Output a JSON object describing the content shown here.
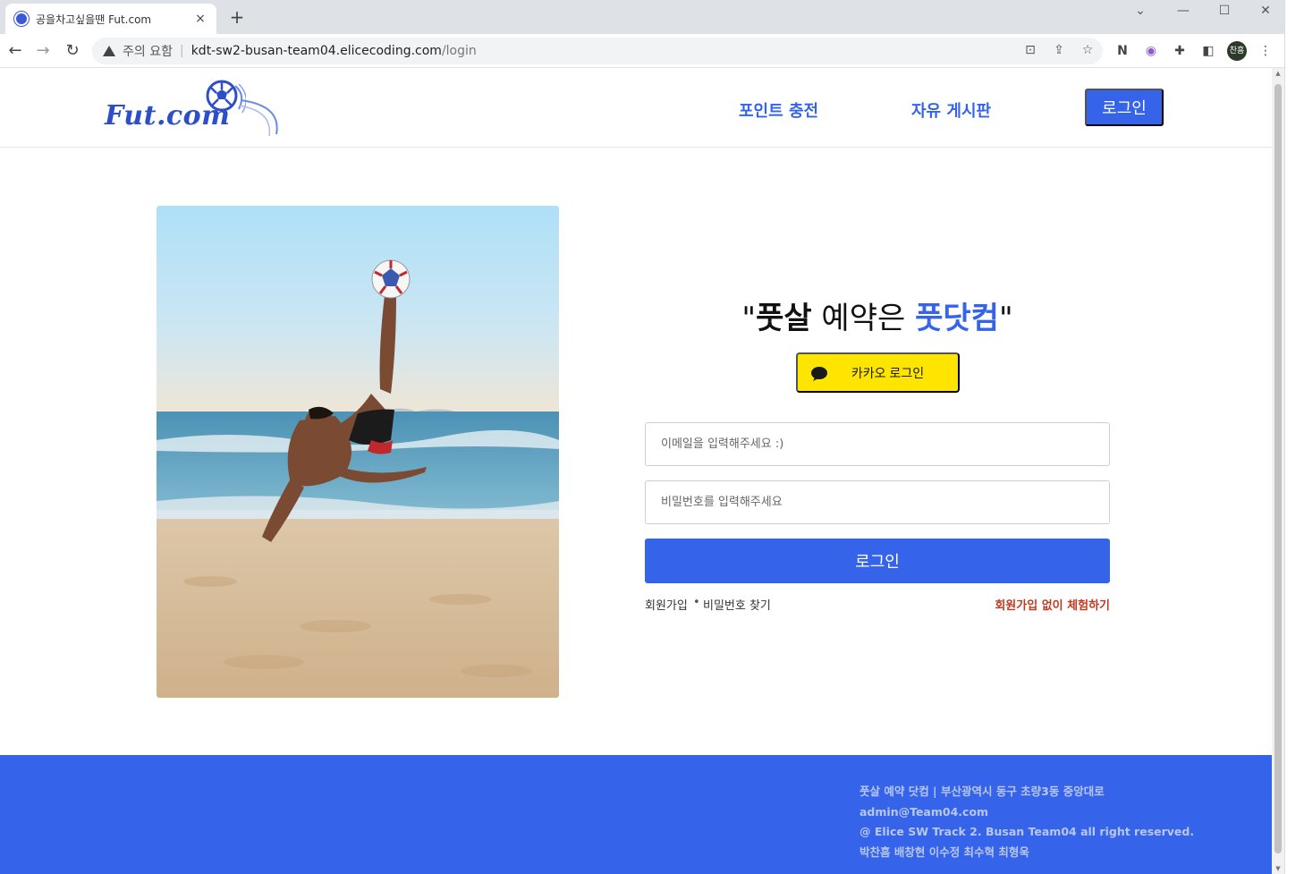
{
  "browser": {
    "tab_title": "공을차고싶을땐 Fut.com",
    "tab_close": "×",
    "new_tab": "+",
    "security_warning": "주의 요함",
    "url_host": "kdt-sw2-busan-team04.elicecoding.com",
    "url_path": "/login",
    "profile_initials": "찬흠"
  },
  "header": {
    "logo_text": "Fut.com",
    "nav": {
      "points": "포인트 충전",
      "board": "자유 게시판",
      "login": "로그인"
    }
  },
  "main": {
    "tagline": {
      "quote_open": "\"",
      "futsal": "풋살",
      "reservation": " 예약은 ",
      "brand": "풋닷컴",
      "quote_close": "\""
    },
    "kakao_login": "카카오 로그인",
    "email_placeholder": "이메일을 입력해주세요 :)",
    "password_placeholder": "비밀번호를 입력해주세요",
    "login_button": "로그인",
    "signup_link": "회원가입",
    "separator": "•",
    "find_password_link": "비밀번호 찾기",
    "trial_link": "회원가입 없이 체험하기"
  },
  "footer": {
    "line1": "풋살 예약 닷컴 | 부산광역시 동구 초량3동 중앙대로",
    "line2": "admin@Team04.com",
    "line3": "@ Elice SW Track 2. Busan Team04 all right reserved.",
    "line4": "박찬흠 배창현 이수정 최수혁 최형욱"
  },
  "colors": {
    "brand_blue": "#3563e9",
    "kakao_yellow": "#fee500",
    "trial_red": "#c03a1f"
  },
  "icons": [
    "back-icon",
    "forward-icon",
    "reload-icon",
    "warning-icon",
    "translate-icon",
    "share-icon",
    "star-icon",
    "extension-icon",
    "sidepanel-icon",
    "menu-icon",
    "kakao-chat-icon"
  ]
}
